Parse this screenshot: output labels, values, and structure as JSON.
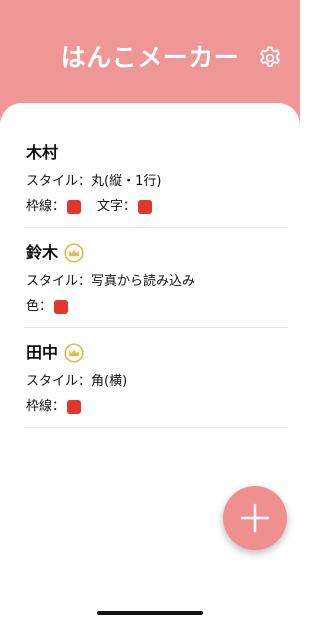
{
  "app": {
    "title": "はんこメーカー"
  },
  "labels": {
    "style_prefix": "スタイル：",
    "frame_prefix": "枠線：",
    "text_prefix": "文字：",
    "color_prefix": "色："
  },
  "colors": {
    "header": "#ef9696",
    "swatch_red": "#e0372a",
    "crown": "#e6b84a",
    "fab": "#ef8f8f"
  },
  "items": [
    {
      "name": "木村",
      "premium": false,
      "style": "丸(縦・1行)",
      "colors": [
        {
          "label": "枠線：",
          "color": "#e0372a"
        },
        {
          "label": "文字：",
          "color": "#e0372a"
        }
      ]
    },
    {
      "name": "鈴木",
      "premium": true,
      "style": "写真から読み込み",
      "colors": [
        {
          "label": "色：",
          "color": "#e0372a"
        }
      ]
    },
    {
      "name": "田中",
      "premium": true,
      "style": "角(横)",
      "colors": [
        {
          "label": "枠線：",
          "color": "#e0372a"
        }
      ]
    }
  ],
  "icons": {
    "settings": "gear-icon",
    "premium": "crown-icon",
    "add": "plus-icon"
  }
}
